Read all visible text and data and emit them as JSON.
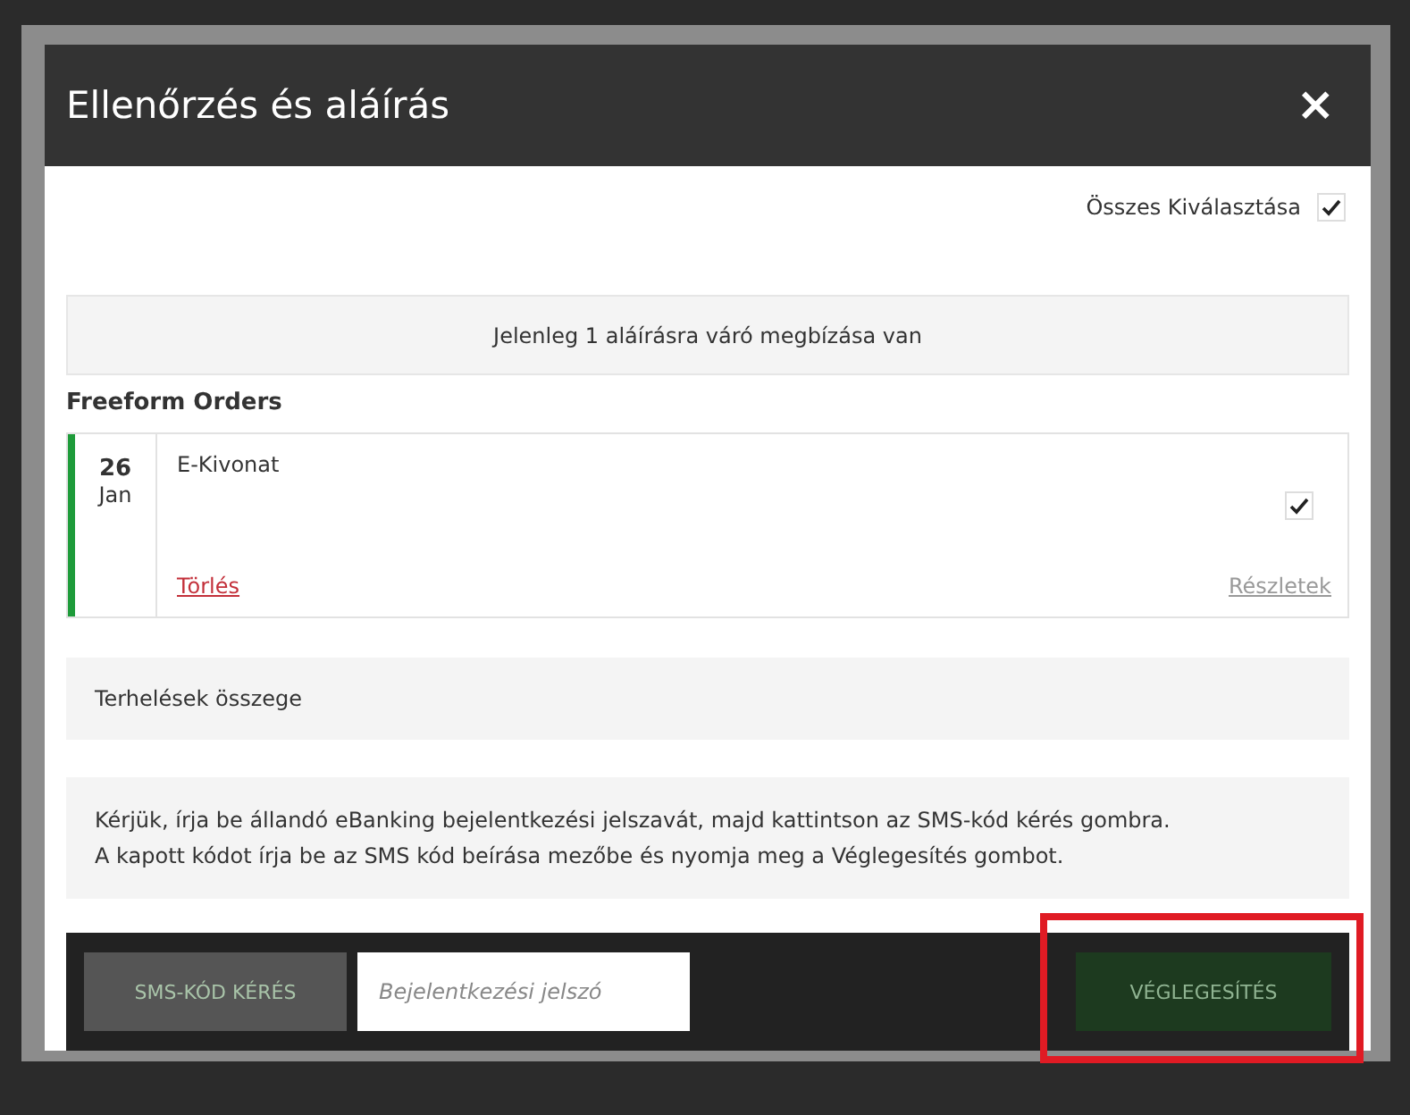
{
  "dialog": {
    "title": "Ellenőrzés és aláírás",
    "close": "×"
  },
  "select_all": {
    "label": "Összes Kiválasztása",
    "checked": true
  },
  "info": "Jelenleg 1 aláírásra váró megbízása van",
  "section_title": "Freeform Orders",
  "orders": [
    {
      "day": "26",
      "month": "Jan",
      "name": "E-Kivonat",
      "checked": true,
      "delete": "Törlés",
      "details": "Részletek",
      "color": "#1e9b3a"
    }
  ],
  "sum_label": "Terhelések összege",
  "instructions": "Kérjük, írja be állandó eBanking bejelentkezési jelszavát, majd kattintson az SMS-kód kérés gombra.\nA kapott kódot írja be az SMS kód beírása mezőbe és nyomja meg a Véglegesítés gombot.",
  "footer": {
    "sms_button": {
      "label": "SMS-KÓD KÉRÉS",
      "disabled": true
    },
    "password": {
      "placeholder": "Bejelentkezési jelszó"
    },
    "finalize_button": {
      "label": "VÉGLEGESÍTÉS",
      "disabled": true,
      "highlighted": true
    }
  }
}
